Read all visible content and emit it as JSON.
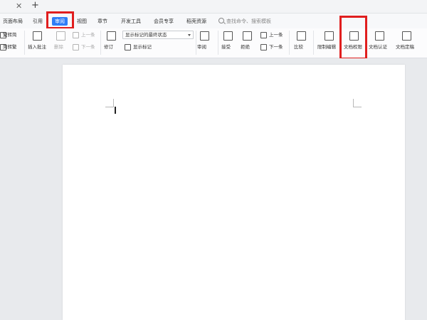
{
  "tabstrip": {
    "close_glyph": "✕",
    "new_tab_glyph": "+"
  },
  "menu": {
    "items": [
      {
        "label": "页面布局"
      },
      {
        "label": "引用"
      },
      {
        "label": "审阅",
        "active": true
      },
      {
        "label": "视图"
      },
      {
        "label": "章节"
      },
      {
        "label": "开发工具"
      },
      {
        "label": "会员专享"
      },
      {
        "label": "稻壳资源"
      }
    ],
    "search_placeholder": "查找命令、搜索模板"
  },
  "ribbon": {
    "left_partial": [
      "繁转简",
      "简转繁"
    ],
    "insert_comment": "插入批注",
    "delete": "删除",
    "prev_comment": "上一条",
    "next_comment": "下一条",
    "revise": "修订",
    "display_mode": "显示标记的最终状态",
    "show_markup": "显示标记",
    "review": "审阅",
    "accept": "接受",
    "reject": "拒绝",
    "prev_change": "上一条",
    "next_change": "下一条",
    "compare": "比较",
    "restrict_edit": "限制编辑",
    "doc_permission": "文档权限",
    "doc_auth": "文档认证",
    "doc_finalize": "文档定稿"
  },
  "accent_color": "#2f7df6",
  "highlight_color": "#e01e1e"
}
